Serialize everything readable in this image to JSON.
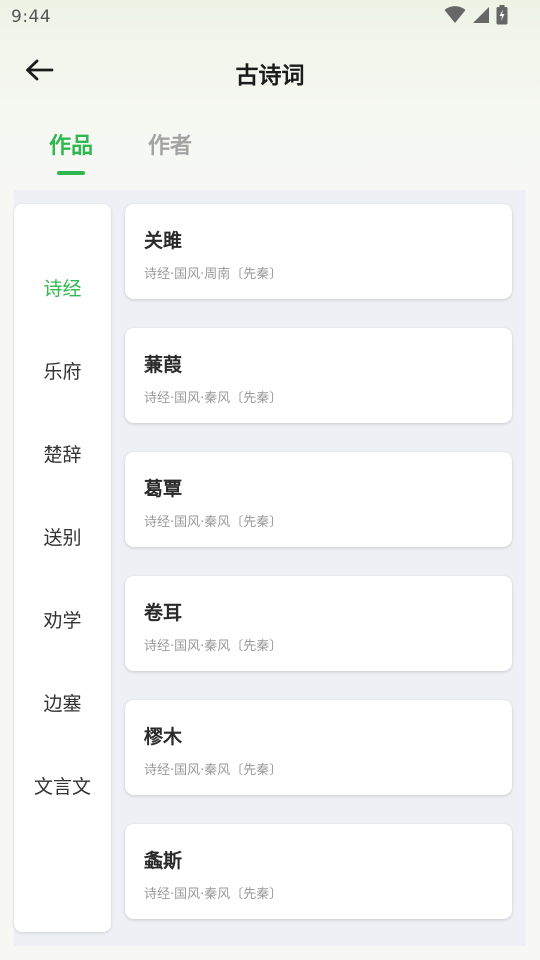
{
  "status_bar": {
    "time": "9:44",
    "icons": [
      "wifi-icon",
      "signal-icon",
      "battery-icon"
    ]
  },
  "header": {
    "back_icon": "arrow-left-icon",
    "title": "古诗词"
  },
  "tabs": [
    {
      "label": "作品",
      "active": true
    },
    {
      "label": "作者",
      "active": false
    }
  ],
  "categories": [
    {
      "label": "诗经",
      "active": true
    },
    {
      "label": "乐府",
      "active": false
    },
    {
      "label": "楚辞",
      "active": false
    },
    {
      "label": "送别",
      "active": false
    },
    {
      "label": "劝学",
      "active": false
    },
    {
      "label": "边塞",
      "active": false
    },
    {
      "label": "文言文",
      "active": false
    }
  ],
  "poems": [
    {
      "title": "关雎",
      "meta": "诗经·国风·周南〔先秦〕"
    },
    {
      "title": "蒹葭",
      "meta": "诗经·国风·秦风〔先秦〕"
    },
    {
      "title": "葛覃",
      "meta": "诗经·国风·秦风〔先秦〕"
    },
    {
      "title": "卷耳",
      "meta": "诗经·国风·秦风〔先秦〕"
    },
    {
      "title": "樛木",
      "meta": "诗经·国风·秦风〔先秦〕"
    },
    {
      "title": "螽斯",
      "meta": "诗经·国风·秦风〔先秦〕"
    }
  ],
  "colors": {
    "accent": "#2fb84f",
    "inactive_tab": "#a3a3a3",
    "panel_bg": "#eef0f5",
    "card_bg": "#ffffff"
  }
}
